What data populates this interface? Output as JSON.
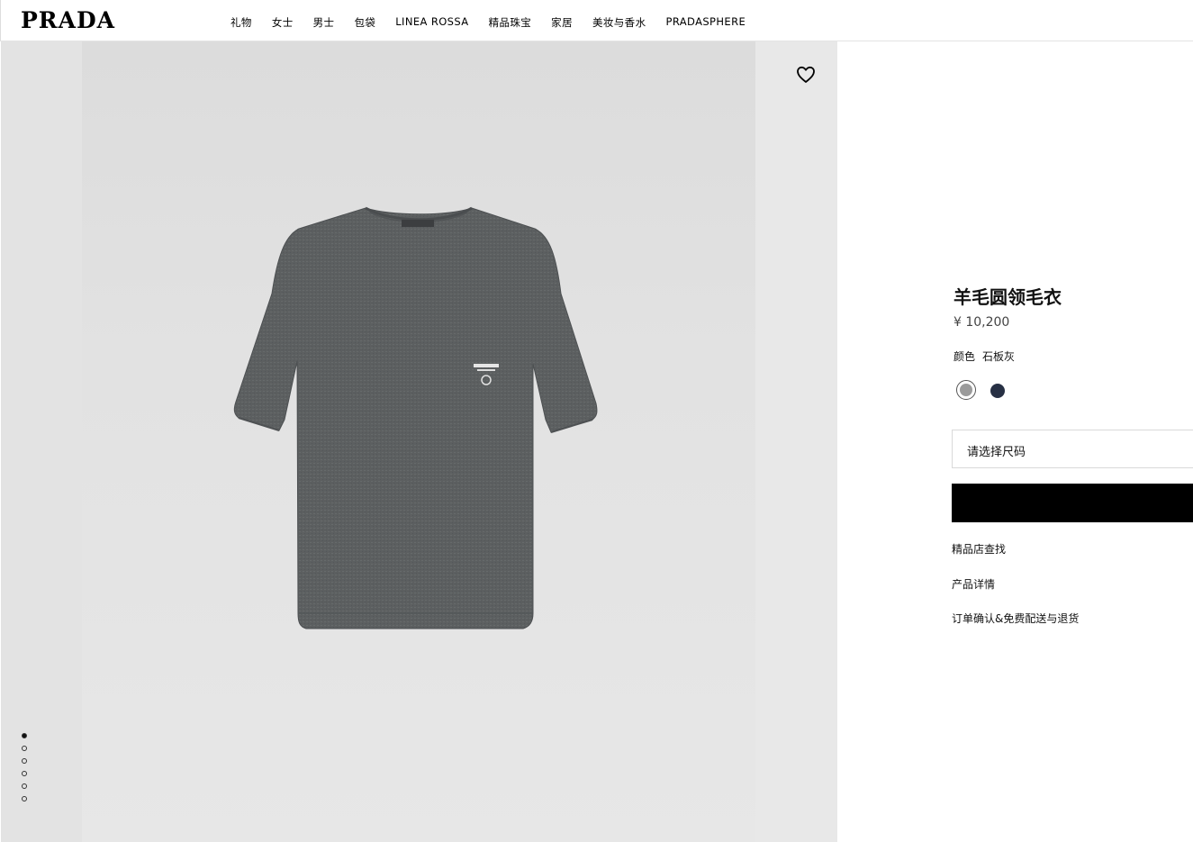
{
  "header": {
    "logo": "PRADA",
    "nav": [
      "礼物",
      "女士",
      "男士",
      "包袋",
      "LINEA ROSSA",
      "精品珠宝",
      "家居",
      "美妆与香水",
      "PRADASPHERE"
    ]
  },
  "gallery": {
    "wishlist_icon": "heart-icon",
    "dot_count": 6,
    "active_dot": 0
  },
  "product": {
    "title": "羊毛圆领毛衣",
    "price": "¥ 10,200",
    "color_label": "颜色",
    "color_value": "石板灰",
    "swatches": [
      {
        "name": "石板灰",
        "color": "#9b9b9b"
      },
      {
        "name": "navy",
        "color": "#273044"
      }
    ],
    "size_placeholder": "请选择尺码",
    "links": [
      "精品店查找",
      "产品详情",
      "订单确认&免费配送与退货"
    ]
  },
  "colors": {
    "sweater": "#5a5d5e",
    "background": "#e3e3e3",
    "accent": "#000000"
  }
}
